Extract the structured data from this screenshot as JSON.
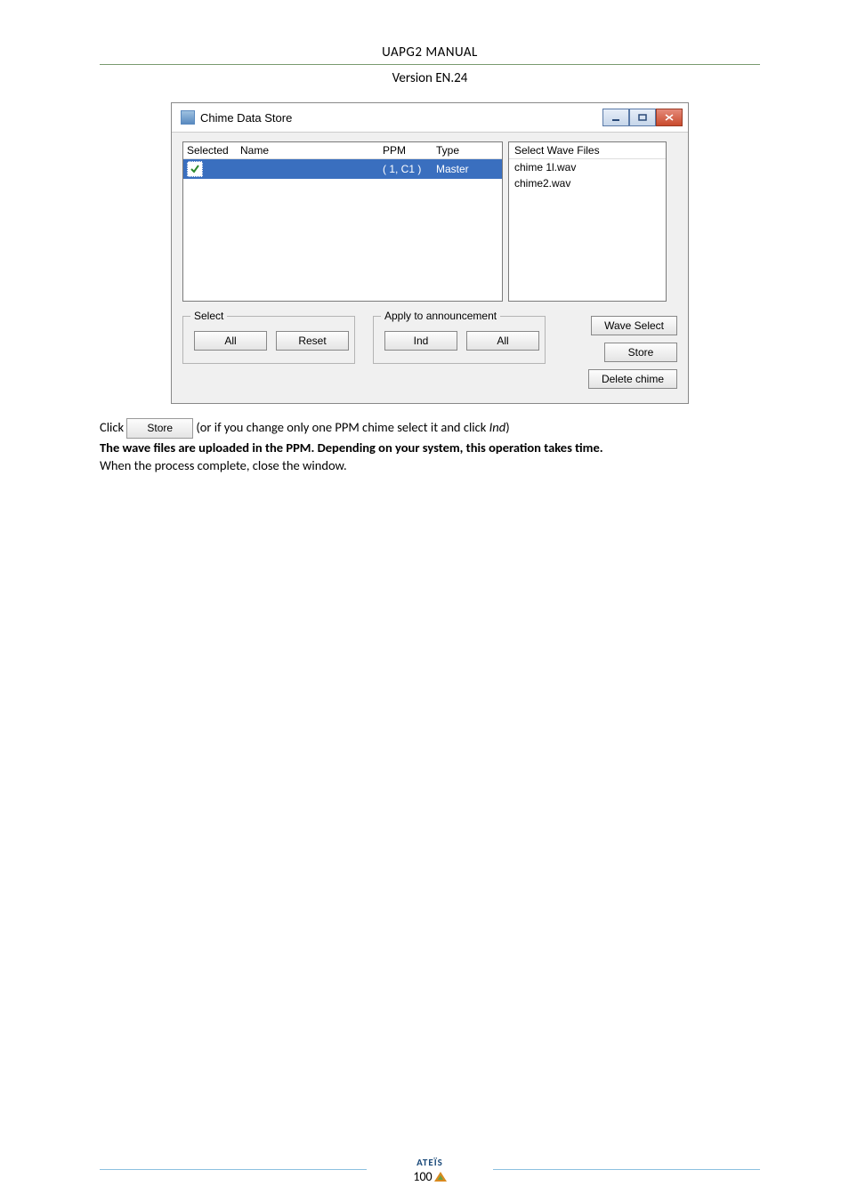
{
  "header": {
    "title": "UAPG2  MANUAL",
    "version": "Version EN.24"
  },
  "dialog": {
    "title": "Chime Data Store",
    "list": {
      "headers": {
        "selected": "Selected",
        "name": "Name",
        "ppm": "PPM",
        "type": "Type"
      },
      "rows": [
        {
          "selected": true,
          "name": "",
          "ppm": "( 1, C1 )",
          "type": "Master"
        }
      ]
    },
    "wave": {
      "header": "Select Wave Files",
      "items": [
        "chime 1l.wav",
        "chime2.wav"
      ]
    },
    "select_group": {
      "title": "Select",
      "all": "All",
      "reset": "Reset"
    },
    "apply_group": {
      "title": "Apply to announcement",
      "ind": "Ind",
      "all": "All"
    },
    "actions": {
      "wave_select": "Wave Select",
      "store": "Store",
      "delete": "Delete chime"
    }
  },
  "body": {
    "click_prefix": "Click ",
    "inline_store": "Store",
    "click_suffix1": "(or if you change only one PPM chime select it and click ",
    "click_ital": "Ind",
    "click_suffix2": ")",
    "bold_line": "The wave files are uploaded in the PPM. Depending on your system, this operation takes time.",
    "final_line": "When the process complete, close the window."
  },
  "footer": {
    "brand": "ATEÏS",
    "page": "100"
  }
}
